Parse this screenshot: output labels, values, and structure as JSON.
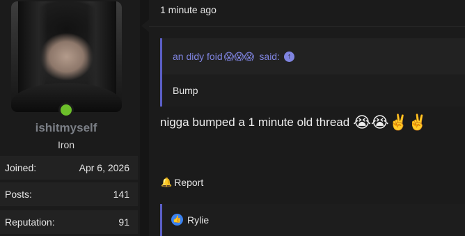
{
  "user": {
    "username": "ishitmyself",
    "rank": "Iron",
    "stats": [
      {
        "label": "Joined:",
        "value": "Apr 6, 2026"
      },
      {
        "label": "Posts:",
        "value": "141"
      },
      {
        "label": "Reputation:",
        "value": "91"
      }
    ],
    "online_color": "#6cbf2a"
  },
  "post": {
    "time": "1 minute ago",
    "quote": {
      "author": "an didy foid",
      "author_emojis": "😱😱😱",
      "said_label": "said:",
      "body": "Bump"
    },
    "text": "nigga bumped a 1 minute old thread",
    "text_emojis": "😭😭✌️✌️",
    "report_label": "Report",
    "reactions": {
      "icon": "thumbs-up-icon",
      "names": "Rylie"
    }
  },
  "colors": {
    "accent": "#5b5fc7",
    "quote_text": "#7f84e0",
    "username": "#7b7f86"
  }
}
